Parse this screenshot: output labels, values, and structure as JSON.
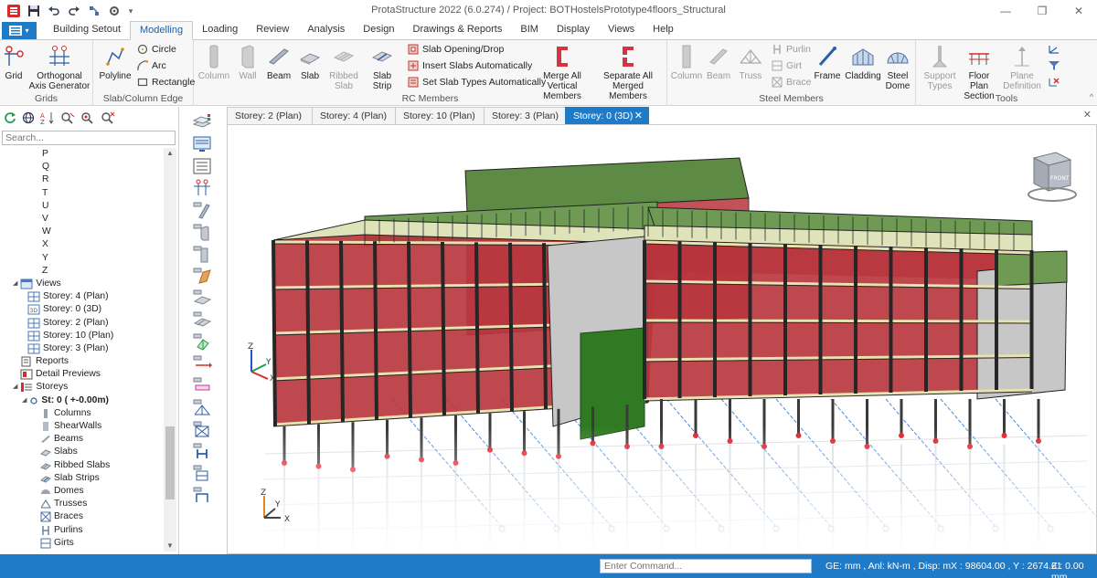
{
  "app": {
    "title": "ProtaStructure 2022 (6.0.274) / Project: BOTHostelsPrototype4floors_Structural"
  },
  "ribbon_tabs": [
    {
      "label": "Building Setout"
    },
    {
      "label": "Modelling",
      "active": true
    },
    {
      "label": "Loading"
    },
    {
      "label": "Review"
    },
    {
      "label": "Analysis"
    },
    {
      "label": "Design"
    },
    {
      "label": "Drawings & Reports"
    },
    {
      "label": "BIM"
    },
    {
      "label": "Display"
    },
    {
      "label": "Views"
    },
    {
      "label": "Help"
    }
  ],
  "ribbon": {
    "grids": {
      "label": "Grids",
      "grid": "Grid",
      "orthogonal_1": "Orthogonal",
      "orthogonal_2": "Axis Generator"
    },
    "slab_edge": {
      "label": "Slab/Column Edge",
      "polyline": "Polyline",
      "circle": "Circle",
      "arc": "Arc",
      "rectangle": "Rectangle"
    },
    "rc_members": {
      "label": "RC Members",
      "column": "Column",
      "wall": "Wall",
      "beam": "Beam",
      "slab": "Slab",
      "ribbed_1": "Ribbed",
      "ribbed_2": "Slab",
      "slab_strip": "Slab Strip",
      "slab_opening": "Slab Opening/Drop",
      "insert_slabs": "Insert Slabs Automatically",
      "set_slab_types": "Set Slab Types Automatically",
      "merge_1": "Merge All",
      "merge_2": "Vertical Members",
      "separate_1": "Separate All",
      "separate_2": "Merged Members"
    },
    "steel_members": {
      "label": "Steel Members",
      "column": "Column",
      "beam": "Beam",
      "truss": "Truss",
      "purlin": "Purlin",
      "girt": "Girt",
      "brace": "Brace",
      "frame": "Frame",
      "cladding": "Cladding",
      "dome_1": "Steel",
      "dome_2": "Dome"
    },
    "tools": {
      "label": "Tools",
      "support_1": "Support",
      "support_2": "Types",
      "floor_plan_1": "Floor Plan",
      "floor_plan_2": "Section",
      "plane_1": "Plane",
      "plane_2": "Definition"
    }
  },
  "left_panel": {
    "search_placeholder": "Search...",
    "letters": [
      "P",
      "Q",
      "R",
      "T",
      "U",
      "V",
      "W",
      "X",
      "Y",
      "Z"
    ],
    "views_label": "Views",
    "views": [
      "Storey: 4 (Plan)",
      "Storey: 0 (3D)",
      "Storey: 2 (Plan)",
      "Storey: 10 (Plan)",
      "Storey: 3 (Plan)"
    ],
    "reports": "Reports",
    "detail_previews": "Detail Previews",
    "storeys": "Storeys",
    "storey_item": "St: 0 ( +-0.00m)",
    "members": [
      "Columns",
      "ShearWalls",
      "Beams",
      "Slabs",
      "Ribbed Slabs",
      "Slab Strips",
      "Domes",
      "Trusses",
      "Braces",
      "Purlins",
      "Girts"
    ]
  },
  "doc_tabs": [
    {
      "label": "Storey: 2 (Plan)"
    },
    {
      "label": "Storey: 4 (Plan)"
    },
    {
      "label": "Storey: 10 (Plan)"
    },
    {
      "label": "Storey: 3 (Plan)"
    },
    {
      "label": "Storey: 0 (3D)",
      "active": true
    }
  ],
  "viewport": {
    "axis_z": "Z",
    "axis_y": "Y",
    "axis_x": "X",
    "cube_front": "FRONT"
  },
  "statusbar": {
    "command_placeholder": "Enter Command...",
    "units": "GE: mm , Anl: kN-m , Disp: m",
    "coords": "X : 98604.00 , Y : 2674.61",
    "z": "Z : 0.00 mm"
  },
  "colors": {
    "accent": "#1f7bc8",
    "slab_red": "#b8343c",
    "frame_dark": "#262626",
    "wall_green": "#2f7a22"
  }
}
